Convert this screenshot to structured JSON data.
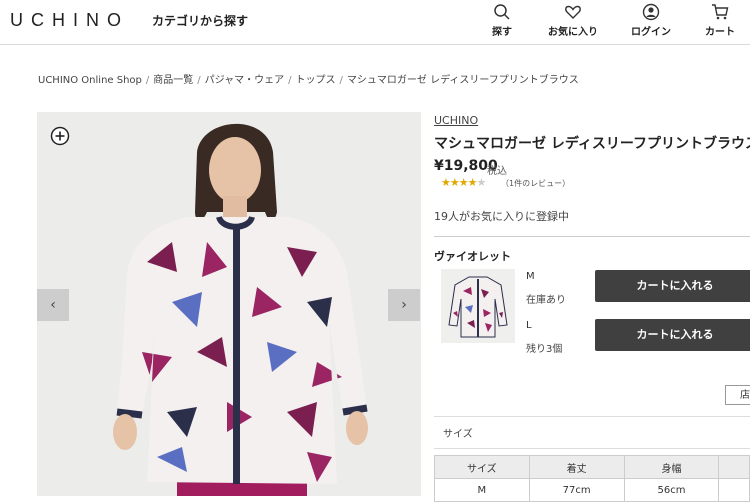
{
  "header": {
    "logo": "UCHINO",
    "category_search": "カテゴリから探す",
    "nav": [
      {
        "label": "探す",
        "icon": "search-icon"
      },
      {
        "label": "お気に入り",
        "icon": "heart-icon"
      },
      {
        "label": "ログイン",
        "icon": "user-icon"
      },
      {
        "label": "カート",
        "icon": "cart-icon"
      }
    ]
  },
  "breadcrumb": [
    "UCHINO Online Shop",
    "商品一覧",
    "パジャマ・ウェア",
    "トップス",
    "マシュマロガーゼ レディスリーフプリントブラウス"
  ],
  "gallery": {
    "prev": "‹",
    "next": "›"
  },
  "product": {
    "brand": "UCHINO",
    "title": "マシュマロガーゼ レディスリーフプリントブラウス",
    "price": "¥19,800",
    "tax": "税込",
    "rating": 4,
    "rating_max": 5,
    "stars_filled": "★★★★",
    "stars_empty": "★",
    "review_count": "（1件のレビュー）",
    "favorites": "19人がお気に入りに登録中",
    "color": "ヴァイオレット",
    "variants": [
      {
        "size": "M",
        "stock": "在庫あり",
        "button": "カートに入れる"
      },
      {
        "size": "L",
        "stock": "残り3個",
        "button": "カートに入れる"
      }
    ],
    "store_button": "店"
  },
  "size_section": {
    "label": "サイズ",
    "headers": [
      "サイズ",
      "着丈",
      "身幅"
    ],
    "rows": [
      [
        "M",
        "77cm",
        "56cm"
      ]
    ]
  },
  "colors": {
    "button_bg": "#404040",
    "accent": "#7a1f4f"
  }
}
